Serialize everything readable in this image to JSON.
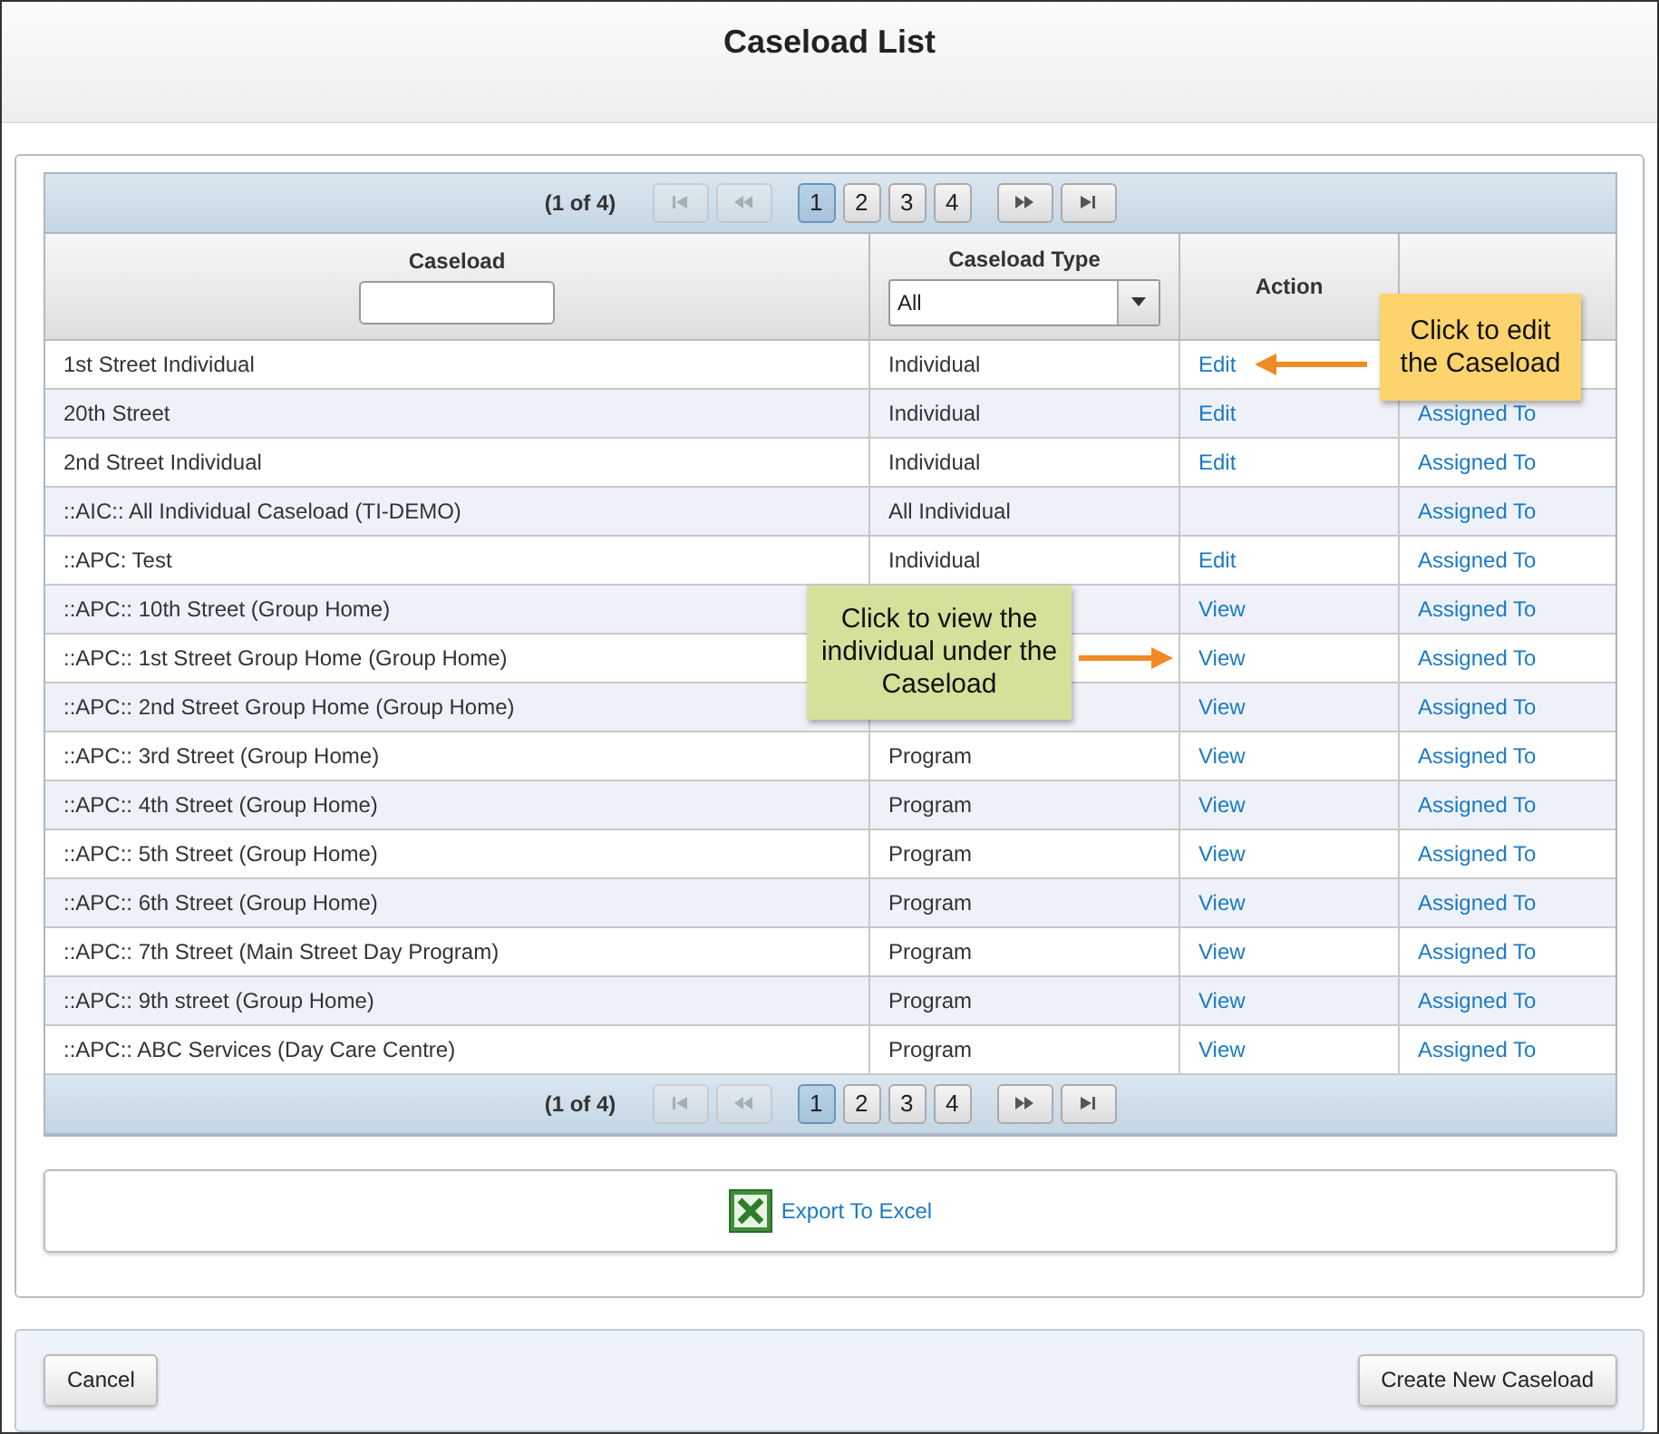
{
  "title": "Caseload List",
  "pagers": [
    {
      "summary": "(1 of 4)",
      "pages": [
        {
          "label": "1",
          "selected": true
        },
        {
          "label": "2",
          "selected": false
        },
        {
          "label": "3",
          "selected": false
        },
        {
          "label": "4",
          "selected": false
        }
      ],
      "first_disabled": true,
      "prev_disabled": true
    },
    {
      "summary": "(1 of 4)",
      "pages": [
        {
          "label": "1",
          "selected": true
        },
        {
          "label": "2",
          "selected": false
        },
        {
          "label": "3",
          "selected": false
        },
        {
          "label": "4",
          "selected": false
        }
      ],
      "first_disabled": true,
      "prev_disabled": true
    }
  ],
  "columns": {
    "caseload": "Caseload",
    "caseload_type": "Caseload Type",
    "type_filter": "All",
    "action": "Action"
  },
  "rows": [
    {
      "caseload": "1st Street Individual",
      "type": "Individual",
      "action": "Edit"
    },
    {
      "caseload": "20th Street",
      "type": "Individual",
      "action": "Edit",
      "assigned": "Assigned To"
    },
    {
      "caseload": "2nd Street Individual",
      "type": "Individual",
      "action": "Edit",
      "assigned": "Assigned To"
    },
    {
      "caseload": "::AIC:: All Individual Caseload (TI-DEMO)",
      "type": "All Individual",
      "assigned": "Assigned To"
    },
    {
      "caseload": "::APC: Test",
      "type": "Individual",
      "action": "Edit",
      "assigned": "Assigned To"
    },
    {
      "caseload": "::APC:: 10th Street (Group Home)",
      "action": "View",
      "assigned": "Assigned To"
    },
    {
      "caseload": "::APC:: 1st Street Group Home (Group Home)",
      "action": "View",
      "assigned": "Assigned To"
    },
    {
      "caseload": "::APC:: 2nd Street Group Home (Group Home)",
      "action": "View",
      "assigned": "Assigned To"
    },
    {
      "caseload": "::APC:: 3rd Street (Group Home)",
      "type": "Program",
      "action": "View",
      "assigned": "Assigned To"
    },
    {
      "caseload": "::APC:: 4th Street (Group Home)",
      "type": "Program",
      "action": "View",
      "assigned": "Assigned To"
    },
    {
      "caseload": "::APC:: 5th Street (Group Home)",
      "type": "Program",
      "action": "View",
      "assigned": "Assigned To"
    },
    {
      "caseload": "::APC:: 6th Street (Group Home)",
      "type": "Program",
      "action": "View",
      "assigned": "Assigned To"
    },
    {
      "caseload": "::APC:: 7th Street (Main Street Day Program)",
      "type": "Program",
      "action": "View",
      "assigned": "Assigned To"
    },
    {
      "caseload": "::APC:: 9th street (Group Home)",
      "type": "Program",
      "action": "View",
      "assigned": "Assigned To"
    },
    {
      "caseload": "::APC:: ABC Services (Day Care Centre)",
      "type": "Program",
      "action": "View",
      "assigned": "Assigned To"
    }
  ],
  "export": "Export To Excel",
  "callouts": [
    {
      "kind": "edit",
      "text": "Click to edit the Caseload"
    },
    {
      "kind": "view",
      "text": "Click to view the individual under the Caseload"
    }
  ],
  "buttons": {
    "cancel": "Cancel",
    "create": "Create New Caseload"
  }
}
